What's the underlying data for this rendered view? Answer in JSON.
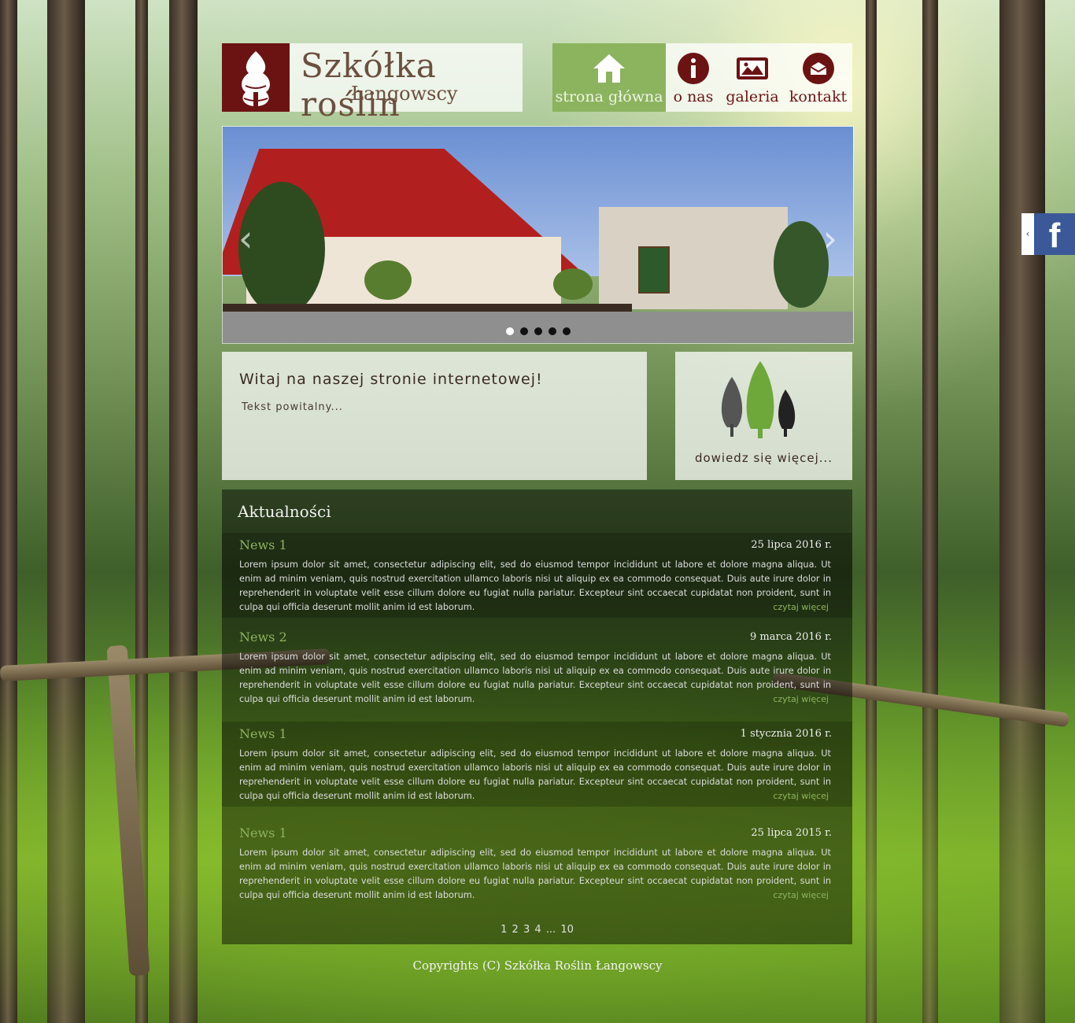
{
  "colors": {
    "brand_dark": "#6b1313",
    "accent_green": "#8cb35e",
    "facebook_blue": "#3b5998"
  },
  "brand": {
    "title": "Szkółka roślin",
    "subtitle": "Łangowscy",
    "logo_icon": "tree-icon"
  },
  "nav": {
    "items": [
      {
        "label": "strona główna",
        "icon": "home-icon",
        "active": true
      },
      {
        "label": "o nas",
        "icon": "info-icon",
        "active": false
      },
      {
        "label": "galeria",
        "icon": "gallery-icon",
        "active": false
      },
      {
        "label": "kontakt",
        "icon": "contact-icon",
        "active": false
      }
    ]
  },
  "slider": {
    "prev": "‹",
    "next": "›",
    "slide_count": 5,
    "active_slide": 1
  },
  "welcome": {
    "heading": "Witaj na naszej stronie internetowej!",
    "text": "Tekst powitalny..."
  },
  "more": {
    "label": "dowiedz się więcej...",
    "icon": "trees-icon"
  },
  "news": {
    "title": "Aktualności",
    "items": [
      {
        "title": "News 1",
        "date": "25 lipca 2016 r.",
        "text": "Lorem ipsum dolor sit amet, consectetur adipiscing elit, sed do eiusmod tempor incididunt ut labore et dolore magna aliqua. Ut enim ad minim veniam, quis nostrud exercitation ullamco laboris nisi ut aliquip ex ea commodo consequat. Duis aute irure dolor in reprehenderit in voluptate velit esse cillum dolore eu fugiat nulla pariatur. Excepteur sint occaecat cupidatat non proident, sunt in culpa qui officia deserunt mollit anim id est laborum.",
        "more": "czytaj więcej"
      },
      {
        "title": "News 2",
        "date": "9 marca 2016 r.",
        "text": "Lorem ipsum dolor sit amet, consectetur adipiscing elit, sed do eiusmod tempor incididunt ut labore et dolore magna aliqua. Ut enim ad minim veniam, quis nostrud exercitation ullamco laboris nisi ut aliquip ex ea commodo consequat. Duis aute irure dolor in reprehenderit in voluptate velit esse cillum dolore eu fugiat nulla pariatur. Excepteur sint occaecat cupidatat non proident, sunt in culpa qui officia deserunt mollit anim id est laborum.",
        "more": "czytaj więcej"
      },
      {
        "title": "News 1",
        "date": "1 stycznia 2016 r.",
        "text": "Lorem ipsum dolor sit amet, consectetur adipiscing elit, sed do eiusmod tempor incididunt ut labore et dolore magna aliqua. Ut enim ad minim veniam, quis nostrud exercitation ullamco laboris nisi ut aliquip ex ea commodo consequat. Duis aute irure dolor in reprehenderit in voluptate velit esse cillum dolore eu fugiat nulla pariatur. Excepteur sint occaecat cupidatat non proident, sunt in culpa qui officia deserunt mollit anim id est laborum.",
        "more": "czytaj więcej"
      },
      {
        "title": "News 1",
        "date": "25 lipca 2015 r.",
        "text": "Lorem ipsum dolor sit amet, consectetur adipiscing elit, sed do eiusmod tempor incididunt ut labore et dolore magna aliqua. Ut enim ad minim veniam, quis nostrud exercitation ullamco laboris nisi ut aliquip ex ea commodo consequat. Duis aute irure dolor in reprehenderit in voluptate velit esse cillum dolore eu fugiat nulla pariatur. Excepteur sint occaecat cupidatat non proident, sunt in culpa qui officia deserunt mollit anim id est laborum.",
        "more": "czytaj więcej"
      }
    ],
    "pager": [
      "1",
      "2",
      "3",
      "4",
      "...",
      "10"
    ]
  },
  "footer": {
    "copyright": "Copyrights (C) Szkółka Roślin Łangowscy"
  },
  "social": {
    "tab_arrow": "‹",
    "facebook_label": "f",
    "icon": "facebook-icon"
  }
}
